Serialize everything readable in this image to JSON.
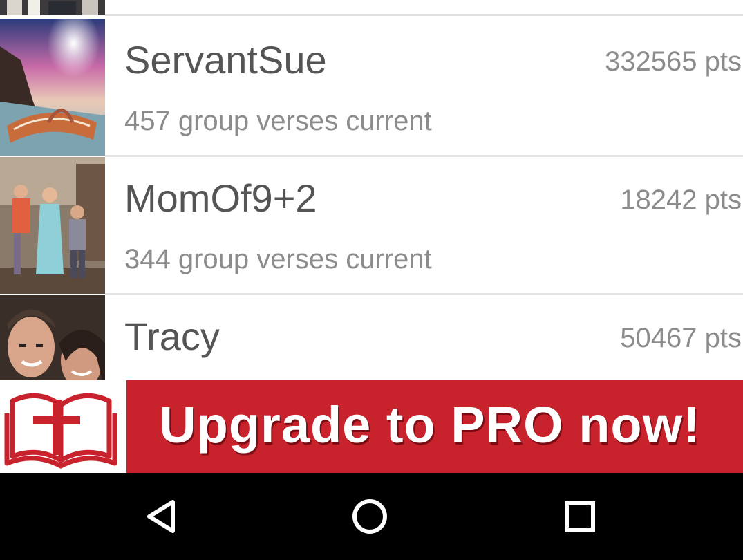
{
  "leaderboard": {
    "rows": [
      {
        "name": "ServantSue",
        "points": "332565 pts",
        "detail": "457 group verses current"
      },
      {
        "name": "MomOf9+2",
        "points": "18242 pts",
        "detail": "344 group verses current"
      },
      {
        "name": "Tracy",
        "points": "50467 pts",
        "detail": ""
      }
    ]
  },
  "banner": {
    "text": "Upgrade to PRO now!",
    "logo_icon": "bible-cross-icon",
    "background_color": "#c8222c"
  },
  "navigation": {
    "back_icon": "back-triangle-icon",
    "home_icon": "home-circle-icon",
    "recents_icon": "recents-square-icon"
  }
}
